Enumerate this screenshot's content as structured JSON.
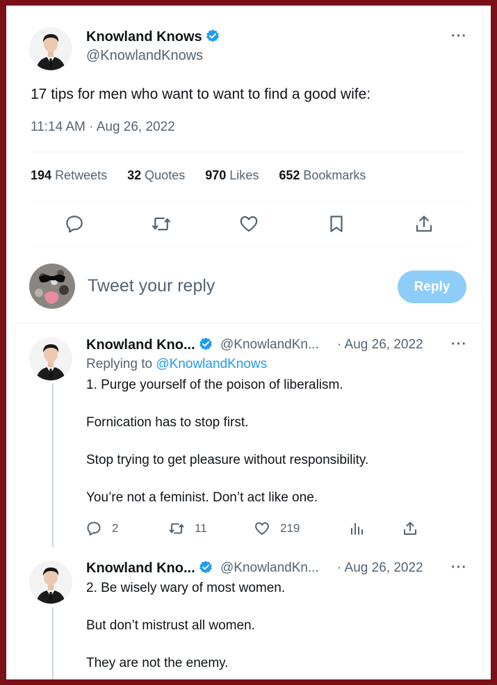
{
  "main_tweet": {
    "author_name": "Knowland Knows",
    "handle": "@KnowlandKnows",
    "text": "17 tips for men who want to want to find a good wife:",
    "timestamp": "11:14 AM · Aug 26, 2022",
    "stats": [
      {
        "count": "194",
        "label": "Retweets"
      },
      {
        "count": "32",
        "label": "Quotes"
      },
      {
        "count": "970",
        "label": "Likes"
      },
      {
        "count": "652",
        "label": "Bookmarks"
      }
    ],
    "more_label": "···"
  },
  "composer": {
    "placeholder": "Tweet your reply",
    "reply_button": "Reply"
  },
  "replies": [
    {
      "author_name": "Knowland Kno...",
      "handle": "@KnowlandKn...",
      "date": "· Aug 26, 2022",
      "replying_prefix": "Replying to",
      "replying_handle": "@KnowlandKnows",
      "lines": [
        "1. Purge yourself of the poison of liberalism.",
        "Fornication has to stop first.",
        "Stop trying to get pleasure without responsibility.",
        "You’re not a feminist. Don’t act like one."
      ],
      "replies_count": "2",
      "retweets_count": "11",
      "likes_count": "219"
    },
    {
      "author_name": "Knowland Kno...",
      "handle": "@KnowlandKn...",
      "date": "· Aug 26, 2022",
      "lines": [
        "2. Be wisely wary of most women.",
        "But don’t mistrust all women.",
        "They are not the enemy."
      ]
    }
  ],
  "colors": {
    "frame": "#7a1018",
    "accent": "#1d9bf0",
    "reply_button": "#8ecdf8",
    "secondary_text": "#536471"
  },
  "icons": [
    "verified-badge-icon",
    "reply-icon",
    "retweet-icon",
    "like-icon",
    "bookmark-icon",
    "share-icon",
    "views-icon",
    "more-icon"
  ]
}
